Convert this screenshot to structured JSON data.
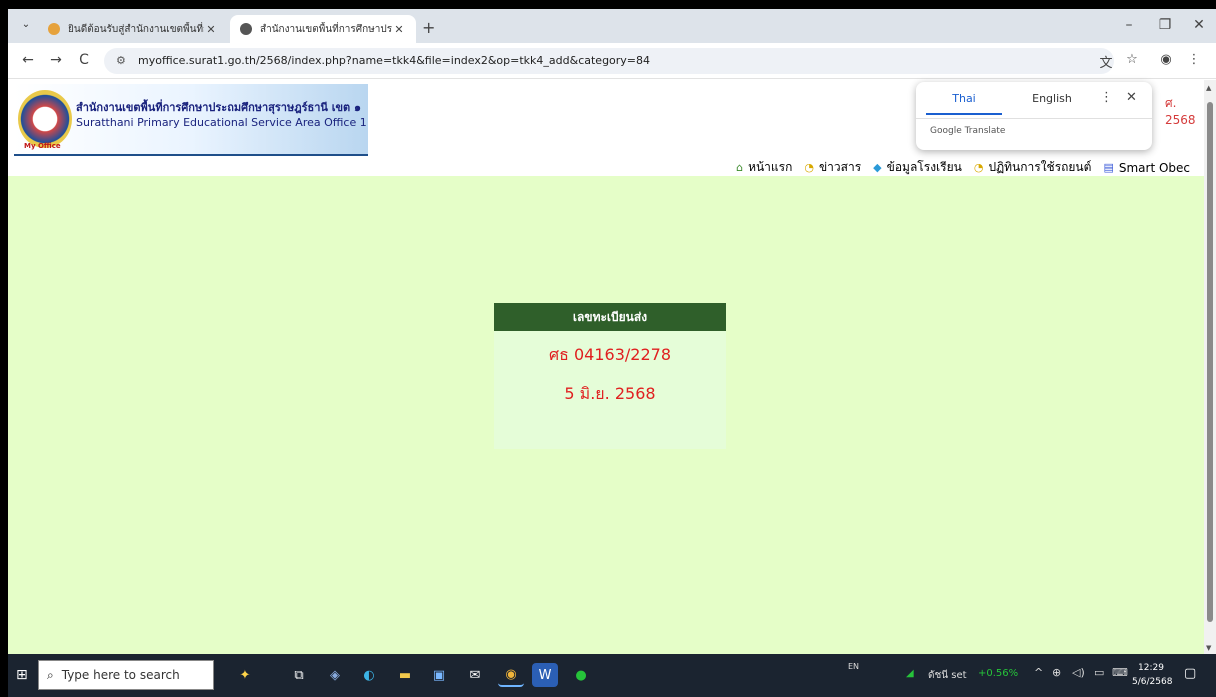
{
  "browser": {
    "tabs": [
      {
        "title": "ยินดีต้อนรับสู่สำนักงานเขตพื้นที่การศึ",
        "active": false
      },
      {
        "title": "สำนักงานเขตพื้นที่การศึกษาประถมศึ",
        "active": true
      }
    ],
    "new_tab": "+",
    "url": "myoffice.surat1.go.th/2568/index.php?name=tkk4&file=index2&op=tkk4_add&category=84",
    "controls": {
      "minimize": "–",
      "restore": "❐",
      "close": "✕",
      "back": "←",
      "forward": "→",
      "reload": "C",
      "tab_menu": "⌄"
    }
  },
  "header": {
    "logo_text": "My Office",
    "title_th": "สำนักงานเขตพื้นที่การศึกษาประถมศึกษาสุราษฎร์ธานี เขต ๑",
    "title_en": "Suratthani Primary Educational Service Area Office 1",
    "year_text": "ศ. 2568"
  },
  "nav": [
    {
      "label": "หน้าแรก",
      "icon": "home-icon"
    },
    {
      "label": "ข่าวสาร",
      "icon": "news-icon"
    },
    {
      "label": "ข้อมูลโรงเรียน",
      "icon": "school-icon"
    },
    {
      "label": "ปฏิทินการใช้รถยนต์",
      "icon": "calendar-icon"
    },
    {
      "label": "Smart Obec",
      "icon": "book-icon"
    }
  ],
  "card": {
    "heading": "เลขทะเบียนส่ง",
    "doc_number": "ศธ 04163/2278",
    "date": "5 มิ.ย. 2568"
  },
  "translate_popup": {
    "lang_from": "Thai",
    "lang_to": "English",
    "footer": "Google Translate",
    "menu": "⋮",
    "close": "✕"
  },
  "taskbar": {
    "search_placeholder": "Type here to search",
    "language": "EN",
    "stock_label": "ดัชนี set",
    "stock_change": "+0.56%",
    "time": "12:29",
    "date": "5/6/2568"
  },
  "colors": {
    "page_bg": "#e5fec8",
    "card_head": "#2f5f2a",
    "number_red": "#e02020"
  }
}
